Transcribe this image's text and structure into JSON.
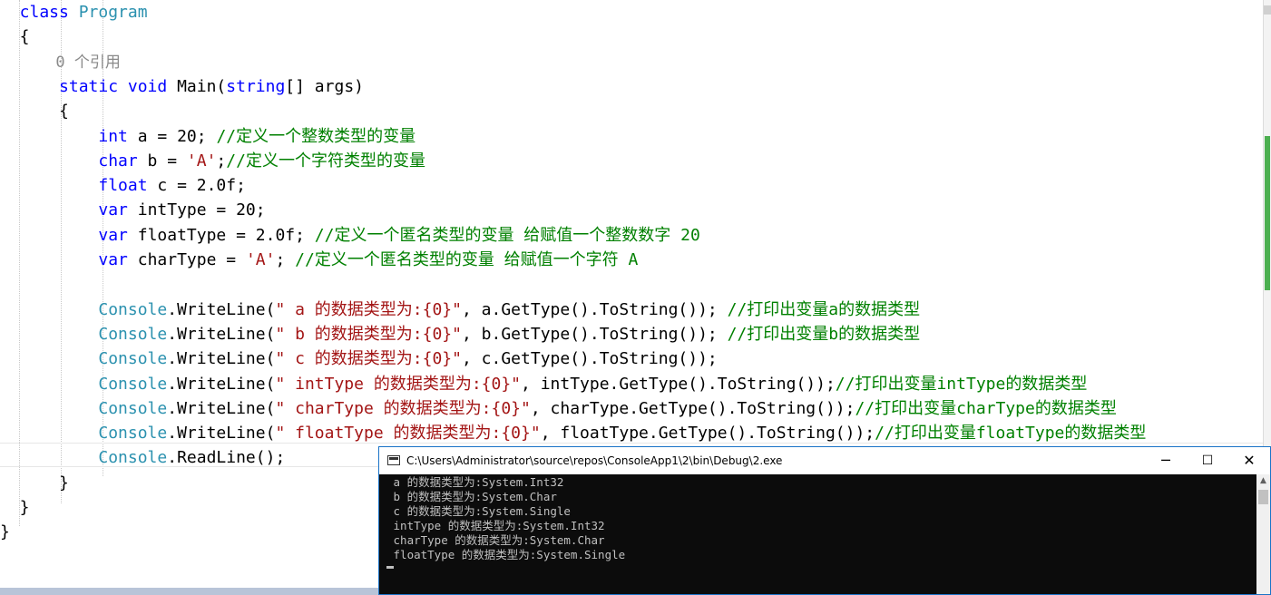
{
  "editor": {
    "code_lines": [
      [
        {
          "t": "  class ",
          "c": "kw"
        },
        {
          "t": "Program",
          "c": "ty"
        }
      ],
      [
        {
          "t": "  {",
          "c": ""
        }
      ],
      [
        {
          "t": "      0 个引用",
          "c": "lens"
        }
      ],
      [
        {
          "t": "      static void ",
          "c": "kw"
        },
        {
          "t": "Main(",
          "c": ""
        },
        {
          "t": "string",
          "c": "kw"
        },
        {
          "t": "[] args)",
          "c": ""
        }
      ],
      [
        {
          "t": "      {",
          "c": ""
        }
      ],
      [
        {
          "t": "          int",
          "c": "kw"
        },
        {
          "t": " a = 20; ",
          "c": ""
        },
        {
          "t": "//定义一个整数类型的变量",
          "c": "cm"
        }
      ],
      [
        {
          "t": "          char",
          "c": "kw"
        },
        {
          "t": " b = ",
          "c": ""
        },
        {
          "t": "'A'",
          "c": "st"
        },
        {
          "t": ";",
          "c": ""
        },
        {
          "t": "//定义一个字符类型的变量",
          "c": "cm"
        }
      ],
      [
        {
          "t": "          float",
          "c": "kw"
        },
        {
          "t": " c = 2.0f;",
          "c": ""
        }
      ],
      [
        {
          "t": "          var",
          "c": "kw"
        },
        {
          "t": " intType = 20;",
          "c": ""
        }
      ],
      [
        {
          "t": "          var",
          "c": "kw"
        },
        {
          "t": " floatType = 2.0f; ",
          "c": ""
        },
        {
          "t": "//定义一个匿名类型的变量 给赋值一个整数数字 20",
          "c": "cm"
        }
      ],
      [
        {
          "t": "          var",
          "c": "kw"
        },
        {
          "t": " charType = ",
          "c": ""
        },
        {
          "t": "'A'",
          "c": "st"
        },
        {
          "t": "; ",
          "c": ""
        },
        {
          "t": "//定义一个匿名类型的变量 给赋值一个字符 A",
          "c": "cm"
        }
      ],
      [
        {
          "t": "",
          "c": ""
        }
      ],
      [
        {
          "t": "          Console",
          "c": "ty"
        },
        {
          "t": ".WriteLine(",
          "c": ""
        },
        {
          "t": "\" a 的数据类型为:{0}\"",
          "c": "st"
        },
        {
          "t": ", a.GetType().ToString()); ",
          "c": ""
        },
        {
          "t": "//打印出变量a的数据类型",
          "c": "cm"
        }
      ],
      [
        {
          "t": "          Console",
          "c": "ty"
        },
        {
          "t": ".WriteLine(",
          "c": ""
        },
        {
          "t": "\" b 的数据类型为:{0}\"",
          "c": "st"
        },
        {
          "t": ", b.GetType().ToString()); ",
          "c": ""
        },
        {
          "t": "//打印出变量b的数据类型",
          "c": "cm"
        }
      ],
      [
        {
          "t": "          Console",
          "c": "ty"
        },
        {
          "t": ".WriteLine(",
          "c": ""
        },
        {
          "t": "\" c 的数据类型为:{0}\"",
          "c": "st"
        },
        {
          "t": ", c.GetType().ToString());",
          "c": ""
        }
      ],
      [
        {
          "t": "          Console",
          "c": "ty"
        },
        {
          "t": ".WriteLine(",
          "c": ""
        },
        {
          "t": "\" intType 的数据类型为:{0}\"",
          "c": "st"
        },
        {
          "t": ", intType.GetType().ToString());",
          "c": ""
        },
        {
          "t": "//打印出变量intType的数据类型",
          "c": "cm"
        }
      ],
      [
        {
          "t": "          Console",
          "c": "ty"
        },
        {
          "t": ".WriteLine(",
          "c": ""
        },
        {
          "t": "\" charType 的数据类型为:{0}\"",
          "c": "st"
        },
        {
          "t": ", charType.GetType().ToString());",
          "c": ""
        },
        {
          "t": "//打印出变量charType的数据类型",
          "c": "cm"
        }
      ],
      [
        {
          "t": "          Console",
          "c": "ty"
        },
        {
          "t": ".WriteLine(",
          "c": ""
        },
        {
          "t": "\" floatType 的数据类型为:{0}\"",
          "c": "st"
        },
        {
          "t": ", floatType.GetType().ToString());",
          "c": ""
        },
        {
          "t": "//打印出变量floatType的数据类型",
          "c": "cm"
        }
      ],
      [
        {
          "t": "          Console",
          "c": "ty"
        },
        {
          "t": ".ReadLine();",
          "c": ""
        }
      ],
      [
        {
          "t": "      }",
          "c": ""
        }
      ],
      [
        {
          "t": "  }",
          "c": ""
        }
      ],
      [
        {
          "t": "}",
          "c": ""
        }
      ]
    ]
  },
  "console": {
    "title": "C:\\Users\\Administrator\\source\\repos\\ConsoleApp1\\2\\bin\\Debug\\2.exe",
    "minimize_icon": "─",
    "maximize_icon": "☐",
    "close_icon": "✕",
    "output_lines": [
      " a 的数据类型为:System.Int32",
      " b 的数据类型为:System.Char",
      " c 的数据类型为:System.Single",
      " intType 的数据类型为:System.Int32",
      " charType 的数据类型为:System.Char",
      " floatType 的数据类型为:System.Single"
    ]
  },
  "colors": {
    "keyword": "#0000ff",
    "type": "#2b91af",
    "string": "#a31515",
    "comment": "#008000",
    "console_bg": "#0c0c0c",
    "console_text": "#c0c0c0"
  }
}
